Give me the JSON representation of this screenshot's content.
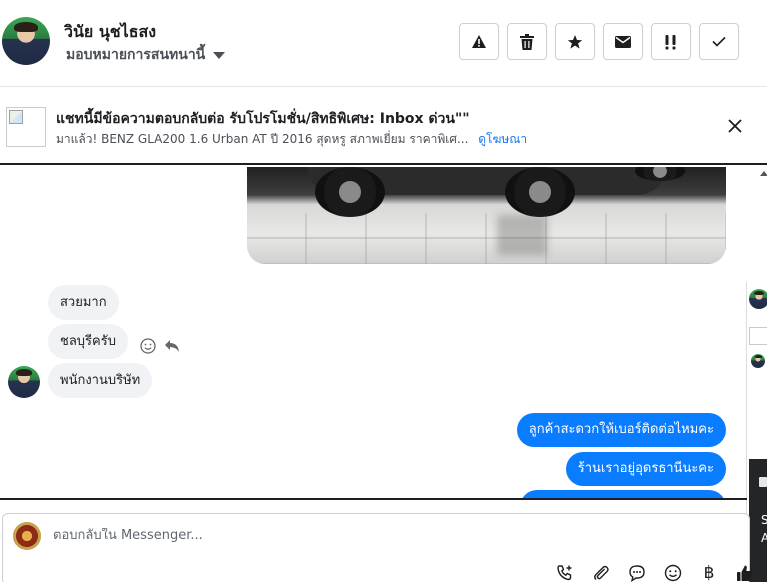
{
  "header": {
    "contact_name": "วินัย นุชไธสง",
    "assign_label": "มอบหมายการสนทนานี้",
    "actions": [
      {
        "icon": "warning-icon",
        "name": "spam-button"
      },
      {
        "icon": "trash-icon",
        "name": "delete-button"
      },
      {
        "icon": "star-icon",
        "name": "star-button"
      },
      {
        "icon": "mail-icon",
        "name": "mark-unread-button"
      },
      {
        "icon": "important-icon",
        "name": "mark-follow-up-button"
      },
      {
        "icon": "check-icon",
        "name": "mark-done-button"
      }
    ]
  },
  "ad_banner": {
    "title": "แชทนี้มีข้อความตอบกลับต่อ รับโปรโมชั่น/สิทธิพิเศษ: Inbox ด่วน\"\"",
    "subtitle": "มาแล้ว! BENZ GLA200 1.6 Urban AT ปี 2016 สุดหรู สภาพเยี่ยม ราคาพิเศ...",
    "link_label": "ดูโฆษณา"
  },
  "messages": {
    "incoming": [
      {
        "text": "สวยมาก"
      },
      {
        "text": "ชลบุรีครับ"
      },
      {
        "text": "พนักงานบริษัท"
      }
    ],
    "outgoing": [
      {
        "text": "ลูกค้าสะดวกให้เบอร์ติดต่อไหมคะ"
      },
      {
        "text": "ร้านเราอยู่อุดรธานีนะคะ"
      }
    ]
  },
  "composer": {
    "placeholder": "ตอบกลับใน Messenger...",
    "icons": [
      "add-call-icon",
      "attachment-icon",
      "saved-reply-icon",
      "emoji-icon",
      "payment-icon",
      "like-icon"
    ],
    "currency_symbol": "฿"
  },
  "side_panel": {
    "line1": "S",
    "line2": "A"
  },
  "colors": {
    "accent": "#0a7cff",
    "link": "#1877f2",
    "incoming_bubble": "#f0f2f5"
  }
}
